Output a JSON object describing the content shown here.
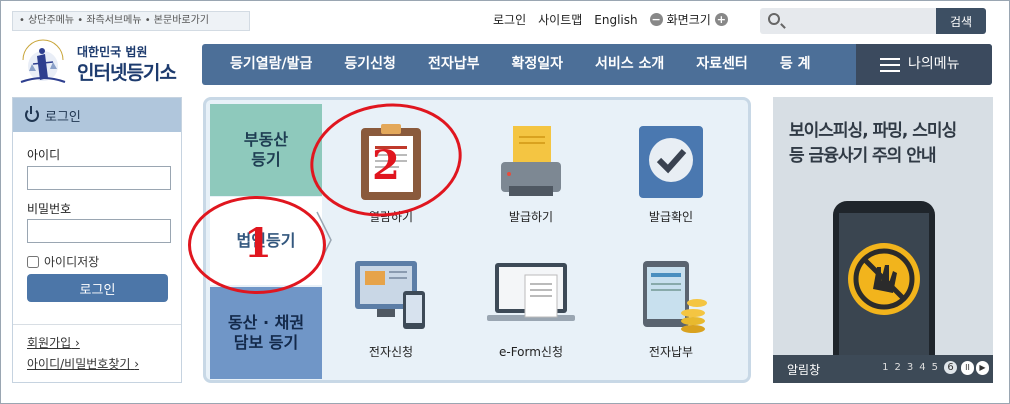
{
  "skip_links": "• 상단주메뉴 • 좌측서브메뉴 • 본문바로가기",
  "util": {
    "login": "로그인",
    "sitemap": "사이트맵",
    "english": "English",
    "zoom_label": "화면크기",
    "zoom_minus": "−",
    "zoom_plus": "+"
  },
  "search": {
    "placeholder": "",
    "button": "검색"
  },
  "logo": {
    "sub": "대한민국 법원",
    "main": "인터넷등기소",
    "emblem_text": "대한민국법원"
  },
  "nav": [
    "등기열람/발급",
    "등기신청",
    "전자납부",
    "확정일자",
    "서비스 소개",
    "자료센터",
    "등 계"
  ],
  "nav_my": "나의메뉴",
  "login": {
    "header": "로그인",
    "id_label": "아이디",
    "pw_label": "비밀번호",
    "save_id": "아이디저장",
    "button": "로그인",
    "join": "회원가입",
    "find": "아이디/비밀번호찾기",
    "link_arrow": "›"
  },
  "categories": [
    "부동산\n등기",
    "법인등기",
    "동산 · 채권\n담보 등기"
  ],
  "tiles": [
    "열람하기",
    "발급하기",
    "발급확인",
    "전자신청",
    "e-Form신청",
    "전자납부"
  ],
  "ad": {
    "title_line1": "보이스피싱, 파밍, 스미싱",
    "title_line2": "등 금융사기 주의 안내",
    "bar_label": "알림창",
    "pages": [
      "1",
      "2",
      "3",
      "4",
      "5",
      "6"
    ],
    "current_page": "6",
    "pause": "II",
    "next": "▶"
  },
  "annotations": {
    "one": "1",
    "two": "2",
    "color": "#e0161f"
  }
}
